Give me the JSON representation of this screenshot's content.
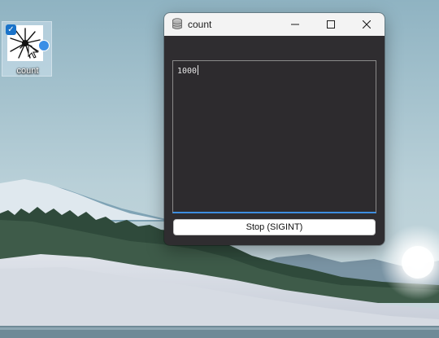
{
  "desktop": {
    "icon": {
      "label": "count",
      "icon_name": "count-app-icon",
      "selected": true
    }
  },
  "window": {
    "title": "count",
    "controls": {
      "minimize": "minimize-icon",
      "maximize": "maximize-icon",
      "close": "close-icon"
    },
    "output": {
      "value": "1000"
    },
    "stop_button": {
      "label": "Stop (SIGINT)"
    }
  },
  "colors": {
    "window_body": "#2f2d30",
    "titlebar": "#f3f3f3",
    "focus_accent": "#3d8ee0",
    "selection_check": "#1a73c9"
  }
}
